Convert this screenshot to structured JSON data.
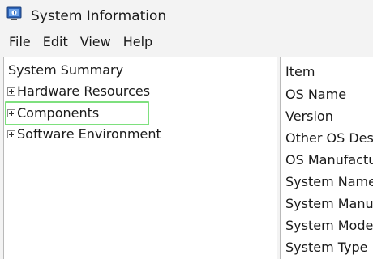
{
  "window": {
    "title": "System Information"
  },
  "menu": {
    "items": [
      "File",
      "Edit",
      "View",
      "Help"
    ]
  },
  "tree": {
    "root": "System Summary",
    "nodes": [
      "Hardware Resources",
      "Components",
      "Software Environment"
    ],
    "selected": "Components",
    "highlight_color": "#7ee07e"
  },
  "details": {
    "column_header": "Item",
    "items": [
      "OS Name",
      "Version",
      "Other OS Desc",
      "OS Manufactu",
      "System Name",
      "System Manuf",
      "System Model",
      "System Type"
    ]
  }
}
